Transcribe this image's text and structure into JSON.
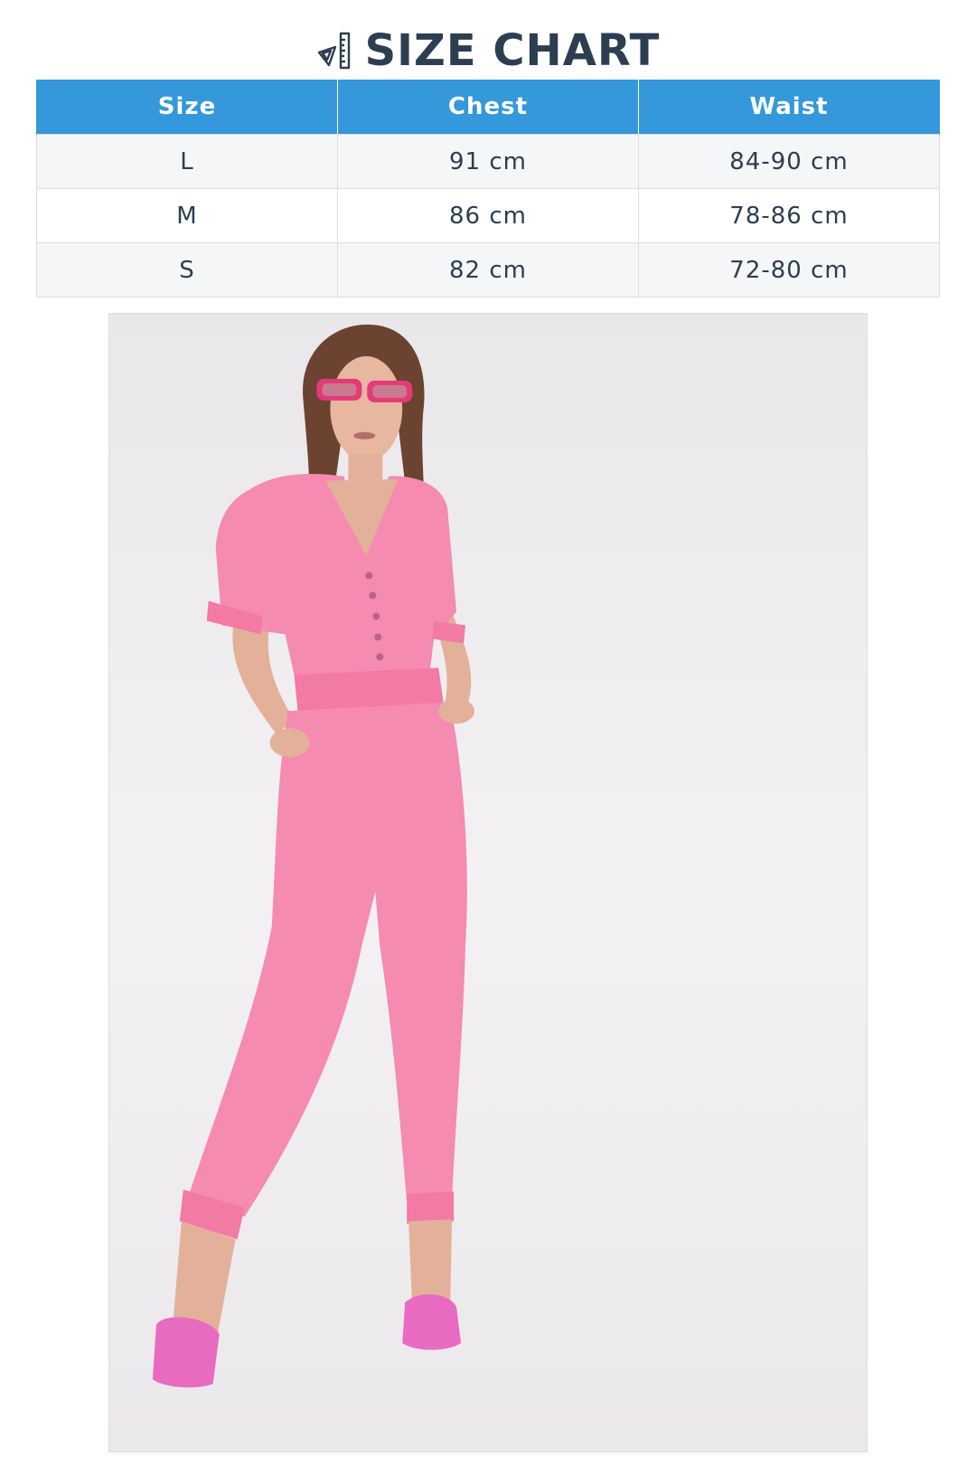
{
  "title": {
    "icon": "ruler-triangle-icon",
    "text": "SIZE CHART"
  },
  "table": {
    "headers": [
      "Size",
      "Chest",
      "Waist"
    ],
    "rows": [
      [
        "L",
        "91 cm",
        "84-90 cm"
      ],
      [
        "M",
        "86 cm",
        "78-86 cm"
      ],
      [
        "S",
        "82 cm",
        "72-80 cm"
      ]
    ]
  },
  "colors": {
    "header_bg": "#3498db",
    "header_text": "#ffffff",
    "title_text": "#2c3e50",
    "row_alt_bg": "#f4f6f7",
    "garment_pink": "#f58bb0"
  }
}
